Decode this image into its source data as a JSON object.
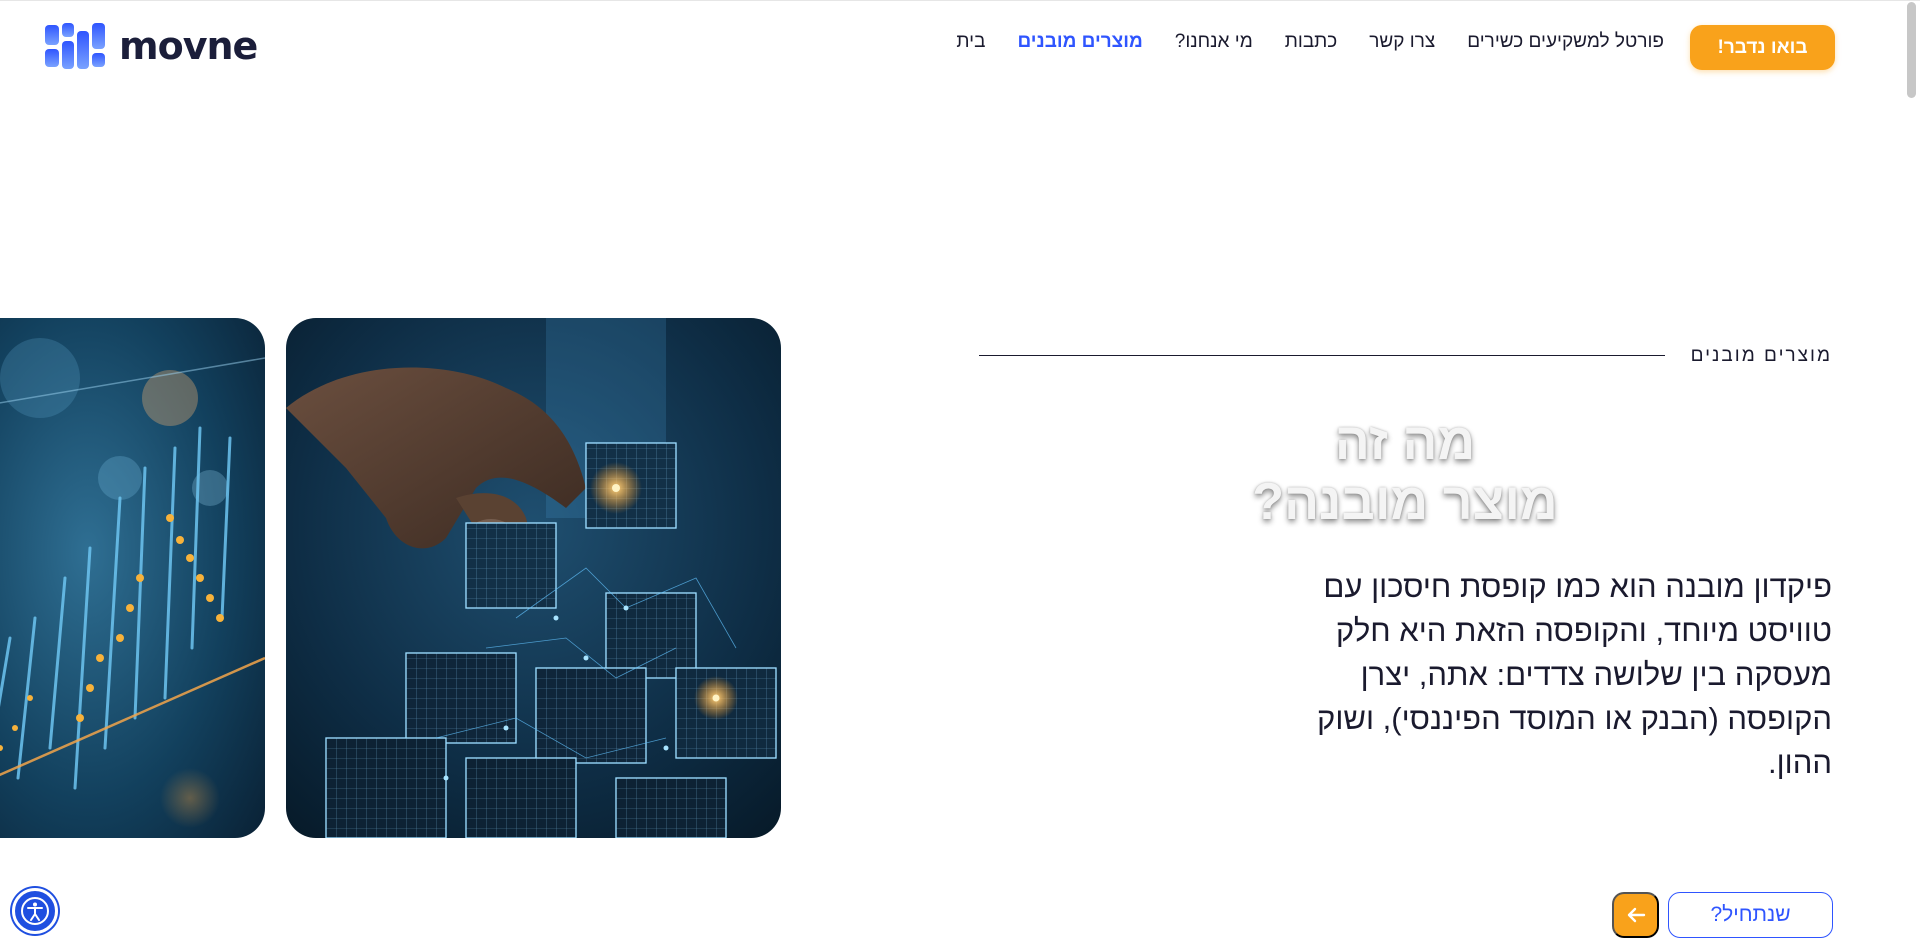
{
  "header": {
    "logo_text": "movne",
    "cta_label": "בואו נדבר!",
    "nav": [
      {
        "label": "בית",
        "active": false
      },
      {
        "label": "מוצרים מובנים",
        "active": true
      },
      {
        "label": "מי אנחנו?",
        "active": false
      },
      {
        "label": "כתבות",
        "active": false
      },
      {
        "label": "צרו קשר",
        "active": false
      },
      {
        "label": "פורטל למשקיעים כשירים",
        "active": false
      }
    ]
  },
  "hero": {
    "section_tag": "מוצרים מובנים",
    "headline_line1": "מה זה",
    "headline_line2": "מוצר מובנה?",
    "body": "פיקדון מובנה הוא כמו קופסת חיסכון עם טוויסט מיוחד, והקופסה הזאת היא חלק מעסקה בין שלושה צדדים: אתה, יצרן הקופסה (הבנק או המוסד הפיננסי), ושוק ההון.",
    "start_button": "שנתחיל?",
    "arrow_icon": "arrow-left-icon"
  },
  "colors": {
    "accent_orange": "#f9a21b",
    "accent_blue": "#2f55ff",
    "text_dark": "#1a1a2e"
  }
}
